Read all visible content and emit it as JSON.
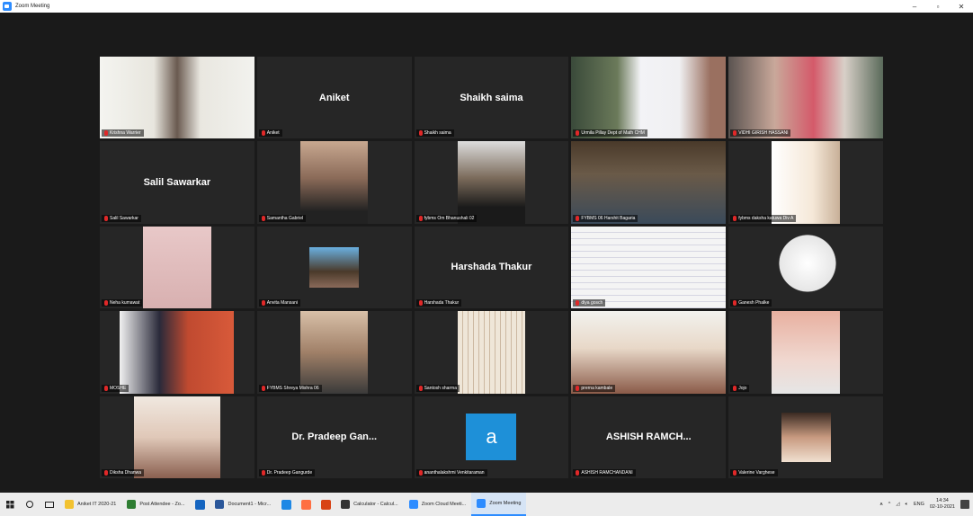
{
  "window": {
    "title": "Zoom Meeting",
    "minimize": "–",
    "restore": "▫",
    "close": "✕"
  },
  "tiles": [
    {
      "name": "Krishna Warrier",
      "display_name": "",
      "kind": "video",
      "active": true
    },
    {
      "name": "Aniket",
      "display_name": "Aniket",
      "kind": "name"
    },
    {
      "name": "Shaikh saima",
      "display_name": "Shaikh saima",
      "kind": "name"
    },
    {
      "name": "Urmila Pillay Dept of Math CHM",
      "display_name": "",
      "kind": "video"
    },
    {
      "name": "VIDHI GIRISH HASSANI",
      "display_name": "",
      "kind": "video"
    },
    {
      "name": "Salil Sawarkar",
      "display_name": "Salil Sawarkar",
      "kind": "name"
    },
    {
      "name": "Samantha Gabriel",
      "display_name": "",
      "kind": "video"
    },
    {
      "name": "fybms Om Bhanushali 02",
      "display_name": "",
      "kind": "video"
    },
    {
      "name": "FYBMS 06 Harshit Bagaria",
      "display_name": "",
      "kind": "video"
    },
    {
      "name": "fybms daksha katuwa Div A",
      "display_name": "",
      "kind": "video"
    },
    {
      "name": "Neha kumawat",
      "display_name": "",
      "kind": "video"
    },
    {
      "name": "Anvita Mansani",
      "display_name": "",
      "kind": "video"
    },
    {
      "name": "Harshada Thakur",
      "display_name": "Harshada Thakur",
      "kind": "name"
    },
    {
      "name": "diya gosch",
      "display_name": "",
      "kind": "video"
    },
    {
      "name": "Ganesh Phalke",
      "display_name": "",
      "kind": "video"
    },
    {
      "name": "MOSHE",
      "display_name": "",
      "kind": "video"
    },
    {
      "name": "FYBMS Shreya Mishra 06",
      "display_name": "",
      "kind": "video"
    },
    {
      "name": "Santosh sharma",
      "display_name": "",
      "kind": "video"
    },
    {
      "name": "prerna kambale",
      "display_name": "",
      "kind": "video"
    },
    {
      "name": "Jojo",
      "display_name": "",
      "kind": "video"
    },
    {
      "name": "Diksha Dhanwa",
      "display_name": "",
      "kind": "video"
    },
    {
      "name": "Dr. Pradeep Gangurde",
      "display_name": "Dr. Pradeep Gan...",
      "kind": "name"
    },
    {
      "name": "ananthalakshmi Venkitaraman",
      "display_name": "",
      "kind": "avatar",
      "avatar_letter": "a"
    },
    {
      "name": "ASHISH RAMCHANDANI",
      "display_name": "ASHISH RAMCH...",
      "kind": "name"
    },
    {
      "name": "Valerine Varghese",
      "display_name": "",
      "kind": "video"
    }
  ],
  "taskbar": {
    "apps": [
      {
        "label": "Aniket IT 2020-21",
        "color": "#f2c230"
      },
      {
        "label": "Post Attendee - Zo...",
        "color": "#2e7d32"
      },
      {
        "label": "",
        "color": "#1565c0"
      },
      {
        "label": "Document1 - Micr...",
        "color": "#2b579a"
      },
      {
        "label": "",
        "color": "#1e88e5"
      },
      {
        "label": "",
        "color": "#ff7043"
      },
      {
        "label": "",
        "color": "#d84315"
      },
      {
        "label": "Calculator - Calcul...",
        "color": "#333333"
      },
      {
        "label": "Zoom Cloud Meeti...",
        "color": "#2d8cff"
      },
      {
        "label": "Zoom Meeting",
        "color": "#2d8cff",
        "active": true
      }
    ],
    "tray_lang": "ENG",
    "time": "14:34",
    "date": "02-10-2021"
  },
  "colors": {
    "tile_bg": "#262626",
    "stage_bg": "#1a1a1a",
    "active_speaker": "#7ddf2e",
    "zoom_blue": "#2d8cff"
  }
}
